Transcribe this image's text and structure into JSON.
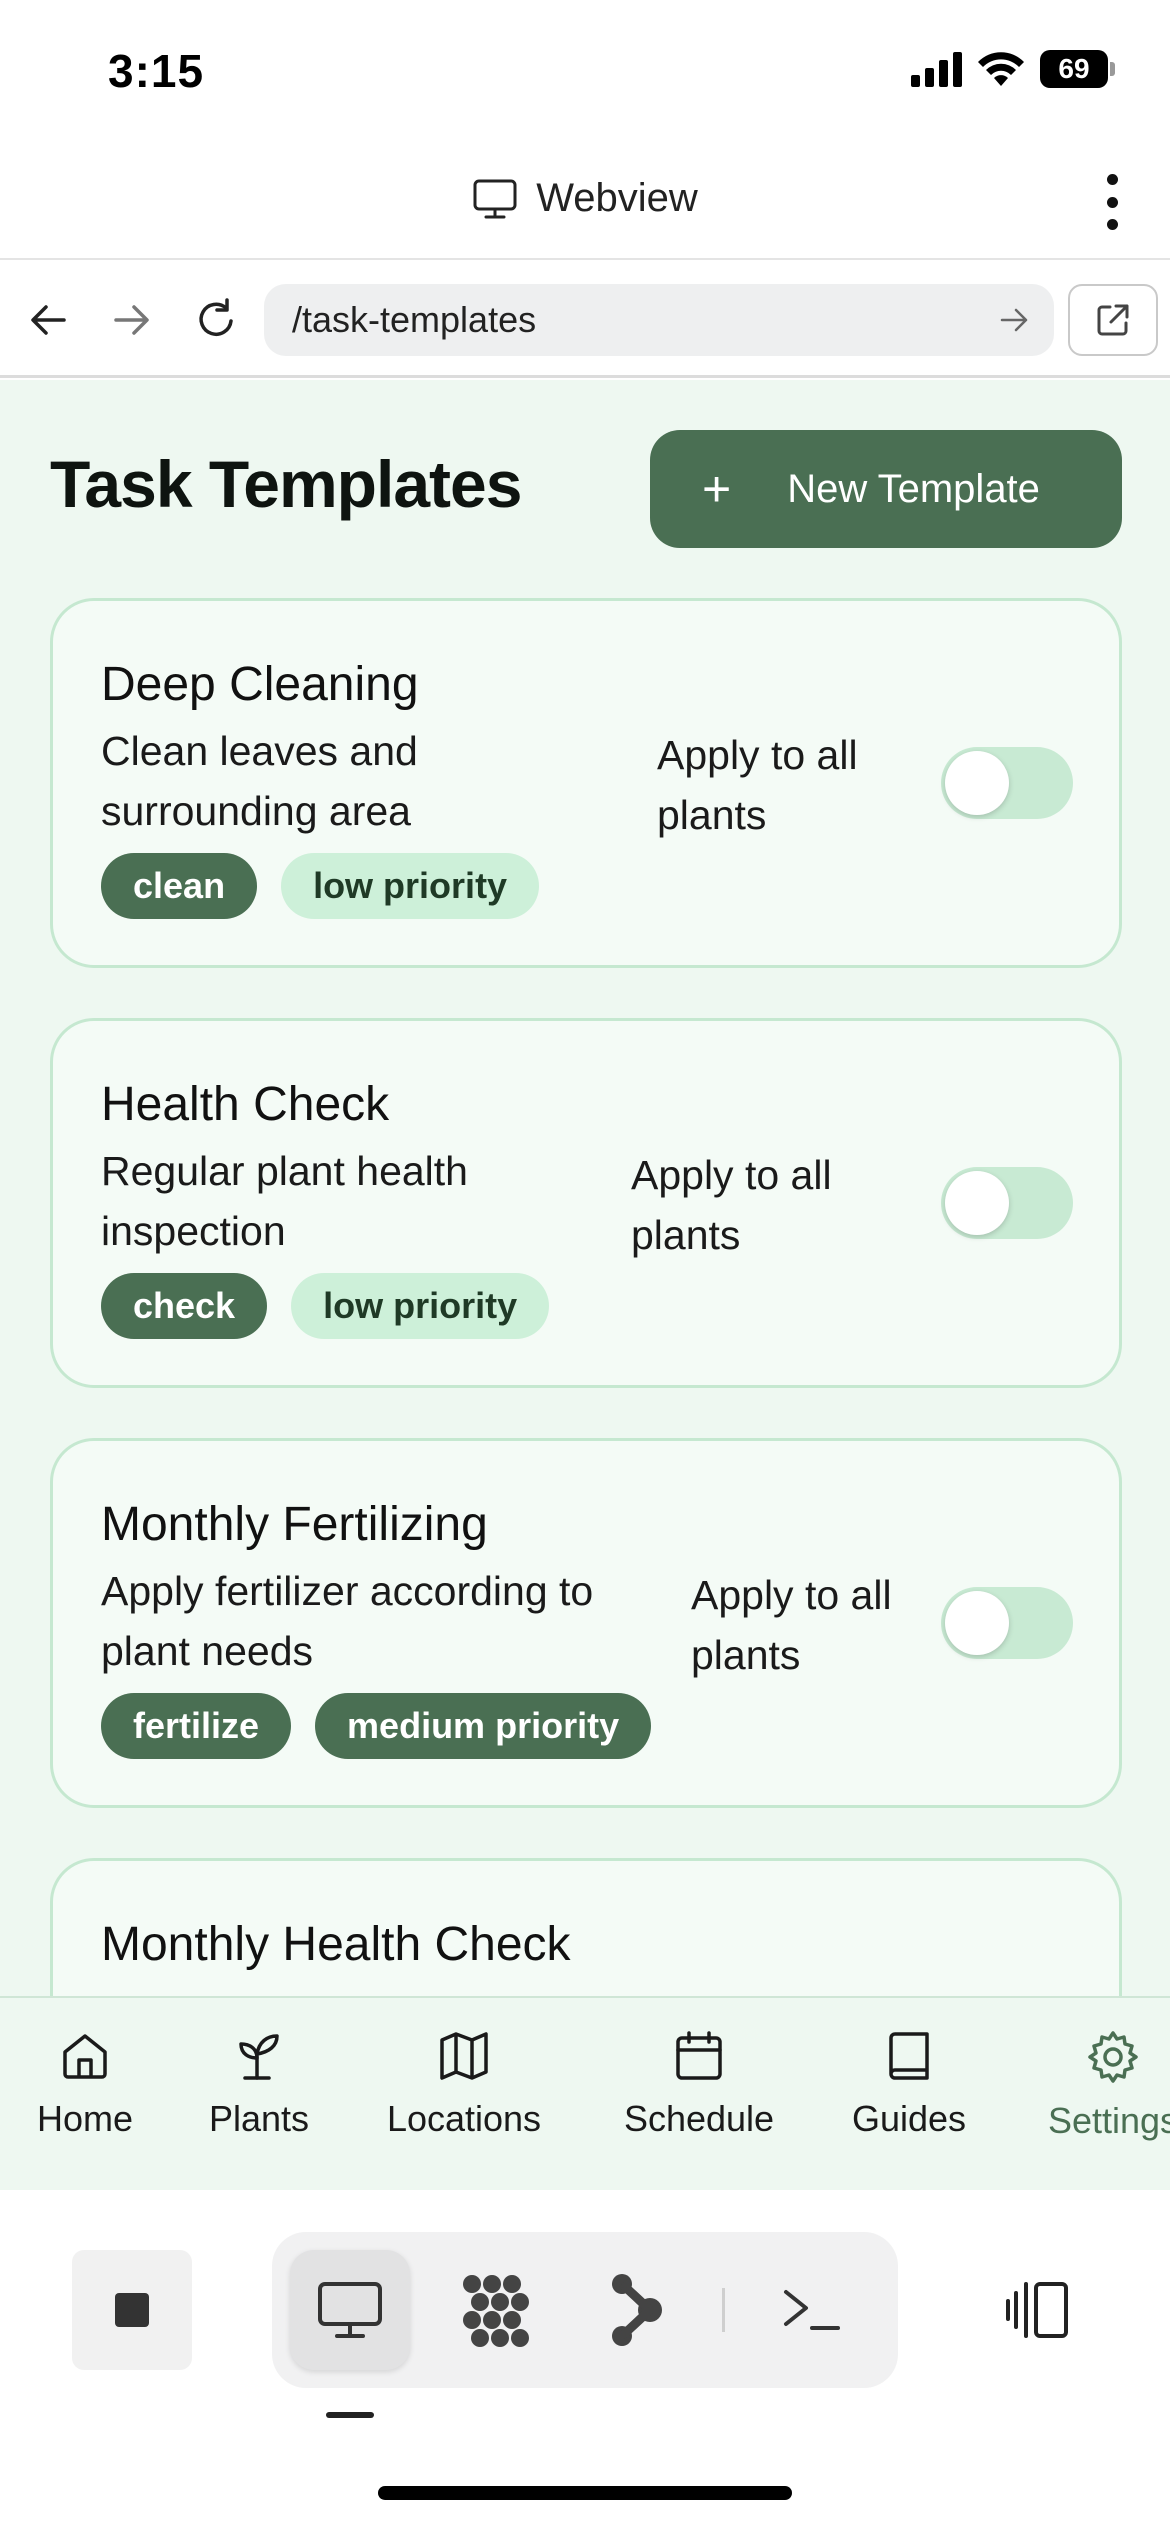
{
  "status_bar": {
    "time": "3:15",
    "battery": "69"
  },
  "webview": {
    "title": "Webview",
    "icon": "monitor-icon"
  },
  "urlbar": {
    "url": "/task-templates"
  },
  "page": {
    "title": "Task Templates",
    "new_button_label": "New Template",
    "new_button_icon": "+"
  },
  "templates": [
    {
      "title": "Deep Cleaning",
      "desc_line1": "Clean leaves and",
      "desc_line2": "surrounding area",
      "apply_line1": "Apply to all",
      "apply_line2": "plants",
      "enabled": false,
      "tag1": "clean",
      "tag2": "low priority",
      "priority": "low"
    },
    {
      "title": "Health Check",
      "desc_line1": "Regular plant health",
      "desc_line2": "inspection",
      "apply_line1": "Apply to all",
      "apply_line2": "plants",
      "enabled": false,
      "tag1": "check",
      "tag2": "low priority",
      "priority": "low"
    },
    {
      "title": "Monthly Fertilizing",
      "desc_line1": "Apply fertilizer according to",
      "desc_line2": "plant needs",
      "apply_line1": "Apply to all",
      "apply_line2": "plants",
      "enabled": false,
      "tag1": "fertilize",
      "tag2": "medium priority",
      "priority": "medium"
    },
    {
      "title": "Monthly Health Check"
    }
  ],
  "bottom_nav": [
    {
      "label": "Home",
      "icon": "home-icon"
    },
    {
      "label": "Plants",
      "icon": "sprout-icon"
    },
    {
      "label": "Locations",
      "icon": "map-icon"
    },
    {
      "label": "Schedule",
      "icon": "calendar-icon"
    },
    {
      "label": "Guides",
      "icon": "book-icon"
    },
    {
      "label": "Settings",
      "icon": "gear-icon",
      "active": true
    }
  ],
  "colors": {
    "accent": "#4a6f53",
    "content_bg": "#eef8f1",
    "card_bg": "#f4fbf6",
    "card_border": "#c5e8d0",
    "tag_light": "#cdf0d9",
    "toggle_off": "#c8ead3"
  }
}
